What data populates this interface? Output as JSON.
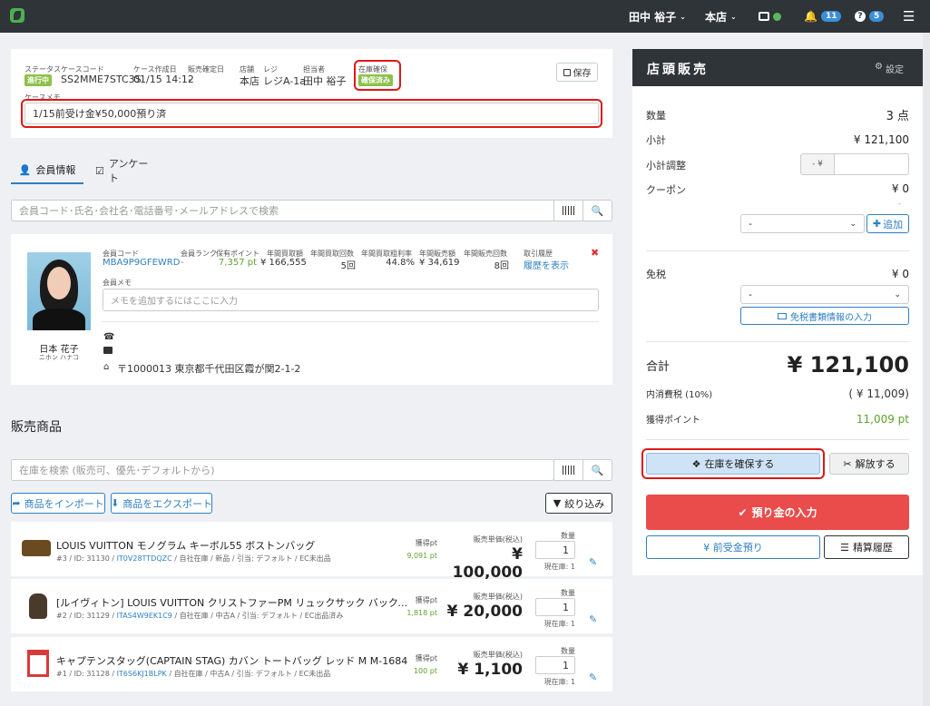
{
  "header": {
    "user": "田中 裕子",
    "store": "本店",
    "notif_count": "11",
    "help_count": "5"
  },
  "case": {
    "status_label": "ステータス",
    "status_value": "進行中",
    "code_label": "ケースコード",
    "code_value": "SS2MME7STC3S",
    "created_label": "ケース作成日",
    "created_value": "01/15 14:12",
    "confirmed_label": "販売確定日",
    "confirmed_value": "-",
    "store_label": "店舗",
    "store_value": "本店",
    "register_label": "レジ",
    "register_value": "レジA-1a",
    "staff_label": "担当者",
    "staff_value": "田中 裕子",
    "stock_label": "在庫確保",
    "stock_value": "確保済み",
    "save_label": "保存",
    "memo_label": "ケースメモ",
    "memo_value": "1/15前受け金¥50,000預り済"
  },
  "tabs": [
    "会員情報",
    "アンケート"
  ],
  "member_search_placeholder": "会員コード･氏名･会社名･電話番号･メールアドレスで検索",
  "member": {
    "name": "日本 花子",
    "kana": "ニホン ハナコ",
    "code_label": "会員コード",
    "code": "MBA9P9GFEWRD",
    "rank_label": "会員ランク",
    "rank": "-",
    "points_label": "保有ポイント",
    "points": "7,357 pt",
    "total_buy_label": "年間買取額",
    "total_buy": "¥ 166,555",
    "buy_count_label": "年間買取回数",
    "buy_count": "5回",
    "margin_label": "年間買取粗利率",
    "margin": "44.8%",
    "sales_label": "年間販売額",
    "sales": "¥ 34,619",
    "sales_count_label": "年間販売回数",
    "sales_count": "8回",
    "history_label": "取引履歴",
    "history_link": "履歴を表示",
    "memo_label": "会員メモ",
    "memo_placeholder": "メモを追加するにはここに入力",
    "address": "〒1000013 東京都千代田区霞が関2-1-2"
  },
  "products_title": "販売商品",
  "stock_search_placeholder": "在庫を検索 (販売可、優先･デフォルトから)",
  "buttons": {
    "import": "商品をインポート",
    "export": "商品をエクスポート",
    "filter": "絞り込み"
  },
  "products": [
    {
      "name": "LOUIS VUITTON モノグラム キーボル55 ボストンバッグ",
      "meta_pre": "#3 / ID: 31130 / ",
      "meta_link": "IT0V28TTDQZC",
      "meta_post": " / 自社在庫 / 新品 / 引当: デフォルト / EC未出品",
      "pt": "9,091 pt",
      "price": "¥ 100,000",
      "qty": "1",
      "stock": "現在庫: 1"
    },
    {
      "name": "[ルイヴィトン] LOUIS VUITTON クリストファーPM リュックサック バックパック モノグラム･マ...",
      "meta_pre": "#2 / ID: 31129 / ",
      "meta_link": "ITAS4W9EK1C9",
      "meta_post": " / 自社在庫 / 中古A / 引当: デフォルト / EC出品済み",
      "pt": "1,818 pt",
      "price": "¥ 20,000",
      "qty": "1",
      "stock": "現在庫: 1"
    },
    {
      "name": "キャプテンスタッグ(CAPTAIN STAG) カバン トートバッグ レッド M M-1684",
      "meta_pre": "#1 / ID: 31128 / ",
      "meta_link": "IT6S6KJ1BLPK",
      "meta_post": " / 自社在庫 / 中古A / 引当: デフォルト / EC未出品",
      "pt": "100 pt",
      "price": "¥ 1,100",
      "qty": "1",
      "stock": "現在庫: 1"
    }
  ],
  "product_labels": {
    "pt": "獲得pt",
    "price": "販売単価(税込)",
    "qty": "数量"
  },
  "panel": {
    "title": "店頭販売",
    "settings": "設定",
    "qty_label": "数量",
    "qty_value": "3 点",
    "subtotal_label": "小計",
    "subtotal_value": "¥ 121,100",
    "adjust_label": "小計調整",
    "adjust_prefix": "- ¥",
    "coupon_label": "クーポン",
    "coupon_value": "¥ 0",
    "coupon_dash": "-",
    "coupon_select": "-",
    "add_label": "追加",
    "taxfree_label": "免税",
    "taxfree_value": "¥ 0",
    "taxfree_select": "-",
    "taxfree_doc": "免税書類情報の入力",
    "total_label": "合計",
    "total_value": "¥ 121,100",
    "tax_label": "内消費税 (10%)",
    "tax_value": "( ¥ 11,009)",
    "points_label": "獲得ポイント",
    "points_value": "11,009 pt",
    "secure_stock": "在庫を確保する",
    "release": "解放する",
    "deposit": "預り金の入力",
    "advance": "¥ 前受金預り",
    "history": "精算履歴"
  },
  "colors": {
    "topbar": "#2f3438",
    "accent": "#2f7fc1",
    "status_green": "#8dc14a",
    "deposit_red": "#ea4b4b",
    "points_green": "#5ea32c"
  }
}
